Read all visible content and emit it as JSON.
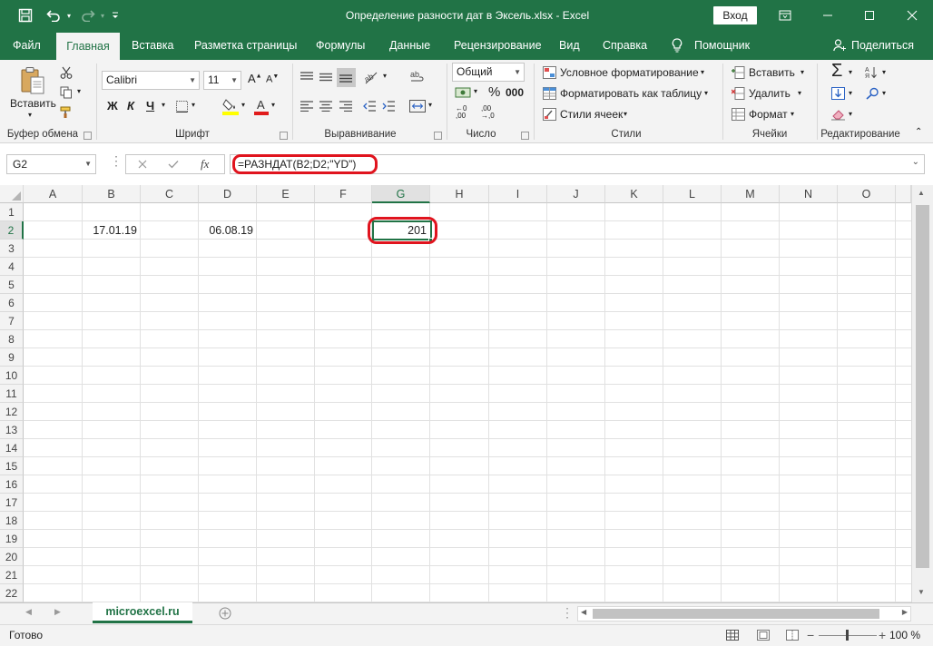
{
  "window": {
    "title": "Определение разности дат в Эксель.xlsx  -  Excel",
    "login_label": "Вход"
  },
  "tabs": [
    "Файл",
    "Главная",
    "Вставка",
    "Разметка страницы",
    "Формулы",
    "Данные",
    "Рецензирование",
    "Вид",
    "Справка",
    "Помощник",
    "Поделиться"
  ],
  "ribbon": {
    "paste_label": "Вставить",
    "font_name": "Calibri",
    "font_size": "11",
    "bold": "Ж",
    "italic": "К",
    "underline": "Ч",
    "number_format": "Общий",
    "conditional_format": "Условное форматирование",
    "format_table": "Форматировать как таблицу",
    "cell_styles": "Стили ячеек",
    "insert": "Вставить",
    "delete": "Удалить",
    "format": "Формат",
    "groups": [
      "Буфер обмена",
      "Шрифт",
      "Выравнивание",
      "Число",
      "Стили",
      "Ячейки",
      "Редактирование"
    ]
  },
  "formula_bar": {
    "name_box": "G2",
    "fx": "fx",
    "formula": "=РАЗНДАТ(B2;D2;\"YD\")"
  },
  "grid": {
    "columns": [
      "A",
      "B",
      "C",
      "D",
      "E",
      "F",
      "G",
      "H",
      "I",
      "J",
      "K",
      "L",
      "M",
      "N",
      "O"
    ],
    "rows": [
      "1",
      "2",
      "3",
      "4",
      "5",
      "6",
      "7",
      "8",
      "9",
      "10",
      "11",
      "12",
      "13",
      "14",
      "15",
      "16",
      "17",
      "18",
      "19",
      "20",
      "21",
      "22"
    ],
    "active_cell": "G2",
    "cells": {
      "B2": "17.01.19",
      "D2": "06.08.19",
      "G2": "201"
    }
  },
  "sheets": [
    "microexcel.ru"
  ],
  "status": {
    "ready": "Готово",
    "zoom": "100 %"
  }
}
